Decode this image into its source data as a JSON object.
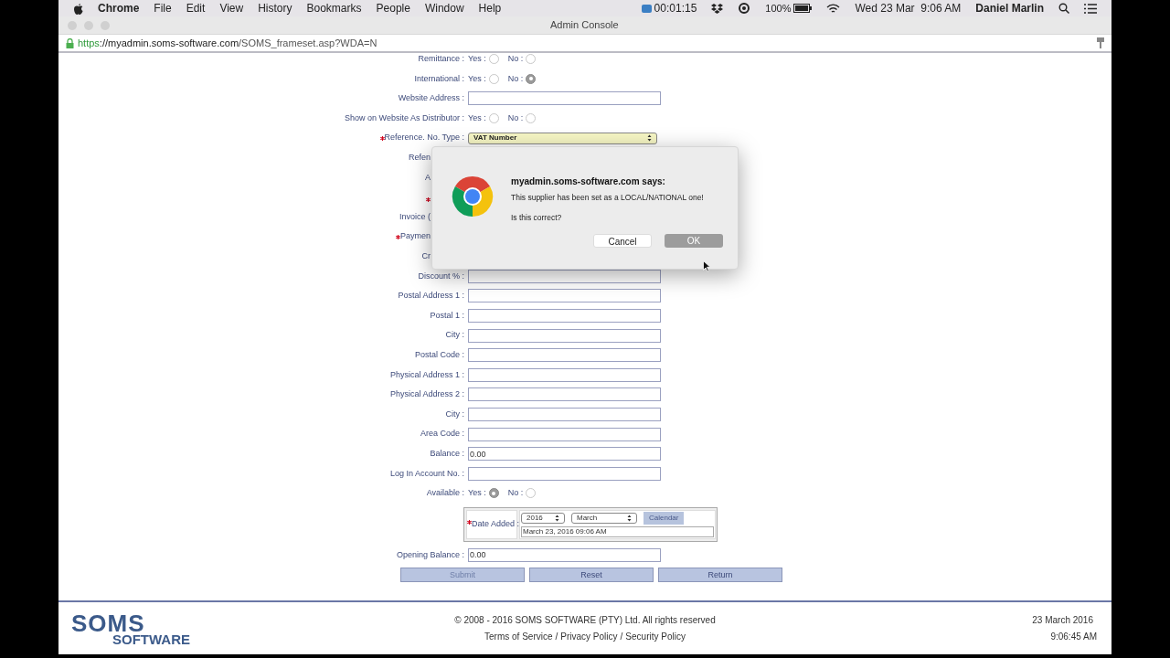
{
  "menu_bar": {
    "app": "Chrome",
    "menus": [
      "File",
      "Edit",
      "View",
      "History",
      "Bookmarks",
      "People",
      "Window",
      "Help"
    ],
    "recording_time": "00:01:15",
    "battery": "100%",
    "datetime": "Wed 23 Mar  9:06 AM",
    "user": "Daniel Marlin"
  },
  "window": {
    "title": "Admin Console"
  },
  "address_bar": {
    "scheme": "https",
    "host": "://myadmin.soms-software.com",
    "path": "/SOMS_frameset.asp?WDA=N"
  },
  "form": {
    "rows": [
      {
        "kind": "radio",
        "label": "Remittance :",
        "options": [
          {
            "label": "Yes :",
            "selected": false
          },
          {
            "label": "No :",
            "selected": false
          }
        ]
      },
      {
        "kind": "radio",
        "label": "International :",
        "options": [
          {
            "label": "Yes :",
            "selected": false
          },
          {
            "label": "No :",
            "selected": true
          }
        ]
      },
      {
        "kind": "text",
        "label": "Website Address :"
      },
      {
        "kind": "radio",
        "label": "Show on Website As Distributor :",
        "options": [
          {
            "label": "Yes :",
            "selected": false
          },
          {
            "label": "No :",
            "selected": false
          }
        ]
      },
      {
        "kind": "select",
        "label": "Reference. No. Type :",
        "required": true,
        "value": "VAT Number"
      },
      {
        "kind": "covered",
        "label": "Refen"
      },
      {
        "kind": "covered",
        "label": "A"
      },
      {
        "kind": "covered",
        "required": true
      },
      {
        "kind": "covered",
        "label": "Invoice ("
      },
      {
        "kind": "covered",
        "label": "Paymen",
        "required": true
      },
      {
        "kind": "covered",
        "label": "Cr"
      },
      {
        "kind": "text",
        "label": "Discount % :"
      },
      {
        "kind": "text",
        "label": "Postal Address 1 :"
      },
      {
        "kind": "text",
        "label": "Postal 1 :"
      },
      {
        "kind": "text",
        "label": "City :"
      },
      {
        "kind": "text",
        "label": "Postal Code :"
      },
      {
        "kind": "text",
        "label": "Physical Address 1 :"
      },
      {
        "kind": "text",
        "label": "Physical Address 2 :"
      },
      {
        "kind": "text",
        "label": "City :"
      },
      {
        "kind": "text",
        "label": "Area Code :"
      },
      {
        "kind": "text",
        "label": "Balance :",
        "value": "0.00"
      },
      {
        "kind": "text",
        "label": "Log In Account No. :"
      },
      {
        "kind": "radio",
        "label": "Available :",
        "options": [
          {
            "label": "Yes :",
            "selected": true
          },
          {
            "label": "No :",
            "selected": false
          }
        ]
      },
      {
        "kind": "date",
        "label": "Date Added :",
        "required": true,
        "year": "2016",
        "month": "March",
        "calendar_button": "Calendar",
        "value": "March 23, 2016 09:06 AM"
      },
      {
        "kind": "text",
        "label": "Opening Balance :",
        "value": "0.00"
      }
    ],
    "buttons": [
      {
        "label": "Submit",
        "disabled": true
      },
      {
        "label": "Reset",
        "disabled": false
      },
      {
        "label": "Return",
        "disabled": false
      }
    ]
  },
  "dialog": {
    "title": "myadmin.soms-software.com says:",
    "message": "This supplier has been set as a LOCAL/NATIONAL one!",
    "question": "Is this correct?",
    "buttons": [
      {
        "label": "Cancel",
        "selected": false
      },
      {
        "label": "OK",
        "selected": true
      }
    ]
  },
  "footer": {
    "logo_top": "SOMS",
    "logo_bottom": "SOFTWARE",
    "copyright": "© 2008 - 2016 SOMS SOFTWARE (PTY) Ltd. All rights reserved",
    "links": [
      "Terms of Service",
      "Privacy Policy",
      "Security Policy"
    ],
    "link_separator": "/",
    "date": "23 March 2016",
    "time": "9:06:45 AM"
  }
}
